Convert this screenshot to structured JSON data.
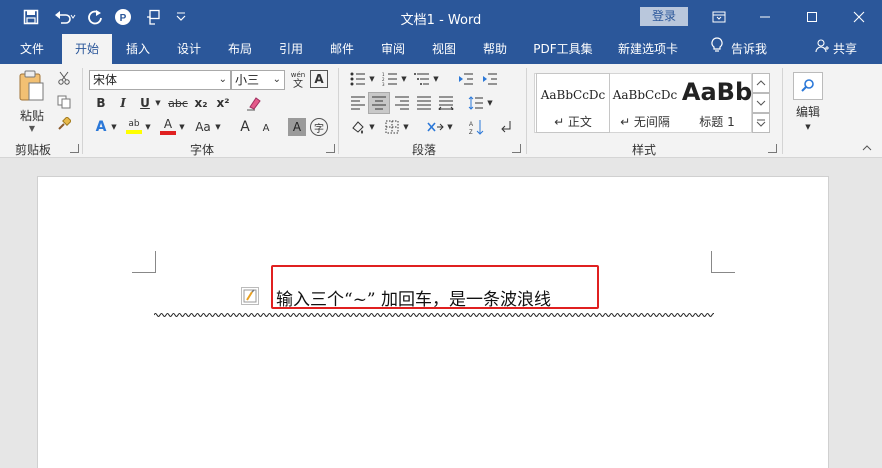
{
  "window": {
    "doc_title": "文档1 - Word",
    "login_label": "登录",
    "colors": {
      "brand": "#2b579a",
      "highlight_box": "#e02020"
    }
  },
  "tabs": [
    {
      "label": "文件"
    },
    {
      "label": "开始"
    },
    {
      "label": "插入"
    },
    {
      "label": "设计"
    },
    {
      "label": "布局"
    },
    {
      "label": "引用"
    },
    {
      "label": "邮件"
    },
    {
      "label": "审阅"
    },
    {
      "label": "视图"
    },
    {
      "label": "帮助"
    },
    {
      "label": "PDF工具集"
    },
    {
      "label": "新建选项卡"
    }
  ],
  "tell_me": "告诉我",
  "share": "共享",
  "ribbon": {
    "clipboard": {
      "paste_label": "粘贴",
      "group": "剪贴板"
    },
    "font": {
      "font_name": "宋体",
      "font_size": "小三",
      "group": "字体",
      "bold": "B",
      "italic": "I",
      "underline": "U",
      "strike": "abc",
      "subscript": "x₂",
      "superscript": "x²",
      "clear_format": "A",
      "text_effect": "A",
      "highlight": "ab",
      "font_color": "A",
      "change_case": "Aa",
      "grow": "A",
      "shrink": "A",
      "char_shade": "A",
      "enclose": "字",
      "phonetic": "wén",
      "char_border": "A"
    },
    "paragraph": {
      "group": "段落"
    },
    "styles": {
      "group": "样式",
      "items": [
        {
          "sample": "AaBbCcDc",
          "name": "↵ 正文"
        },
        {
          "sample": "AaBbCcDc",
          "name": "↵ 无间隔"
        },
        {
          "sample": "AaBb",
          "name": "标题 1"
        }
      ]
    },
    "editing": {
      "label": "编辑"
    }
  },
  "document": {
    "text": "输入三个“~” 加回车，是一条波浪线"
  }
}
